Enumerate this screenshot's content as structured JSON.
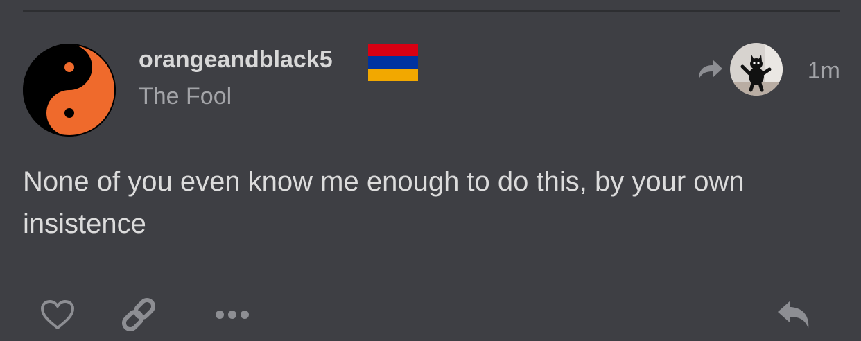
{
  "post": {
    "username": "orangeandblack5",
    "flag_colors": [
      "#d90012",
      "#0033a0",
      "#f2a800"
    ],
    "user_title": "The Fool",
    "timestamp": "1m",
    "body": "None of you even know me enough to do this, by your own insistence"
  },
  "icons": {
    "avatar": "yin-yang-icon",
    "share": "share-arrow-icon",
    "reply_to_avatar": "black-cat-avatar",
    "like": "heart-icon",
    "link": "link-icon",
    "more": "more-dots-icon",
    "reply": "reply-icon"
  },
  "colors": {
    "background": "#3e3f44",
    "avatar_orange": "#ef6a2c",
    "icon_gray": "#8d8e93"
  }
}
